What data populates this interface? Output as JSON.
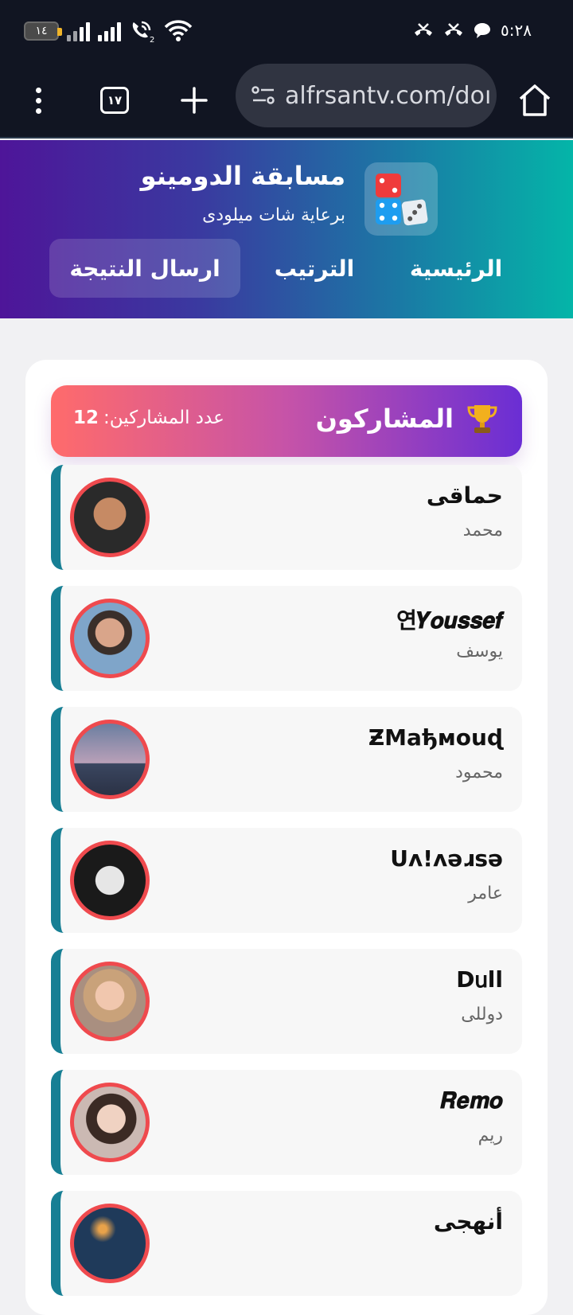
{
  "status_bar": {
    "battery": "١٤",
    "time": "٥:٢٨",
    "sim_label": "2"
  },
  "browser": {
    "tab_count": "١٧",
    "url": "alfrsantv.com/doı"
  },
  "site": {
    "title": "مسابقة الدومينو",
    "subtitle": "برعاية شات ميلودى",
    "nav": {
      "home": "الرئيسية",
      "ranking": "الترتيب",
      "submit": "ارسال النتيجة"
    }
  },
  "participants": {
    "heading": "المشاركون",
    "count_label": "عدد المشاركين:",
    "count": "12",
    "items": [
      {
        "name": "حماقى",
        "subtitle": "محمد"
      },
      {
        "name": "연𝒀𝒐𝒖𝒔𝒔𝒆𝒇",
        "subtitle": "يوسف"
      },
      {
        "name": "ƵMaђмouɖ",
        "subtitle": "محمود"
      },
      {
        "name": "Uʌ!ʌǝɹsǝ",
        "subtitle": "عامر"
      },
      {
        "name": "D𐌵ll",
        "subtitle": "دوللى"
      },
      {
        "name": "𝑹𝒆𝒎𝒐",
        "subtitle": "ريم"
      },
      {
        "name": "أنهجى",
        "subtitle": ""
      }
    ]
  },
  "colors": {
    "accent_border": "#177f94",
    "avatar_ring": "#ef4a4e"
  }
}
